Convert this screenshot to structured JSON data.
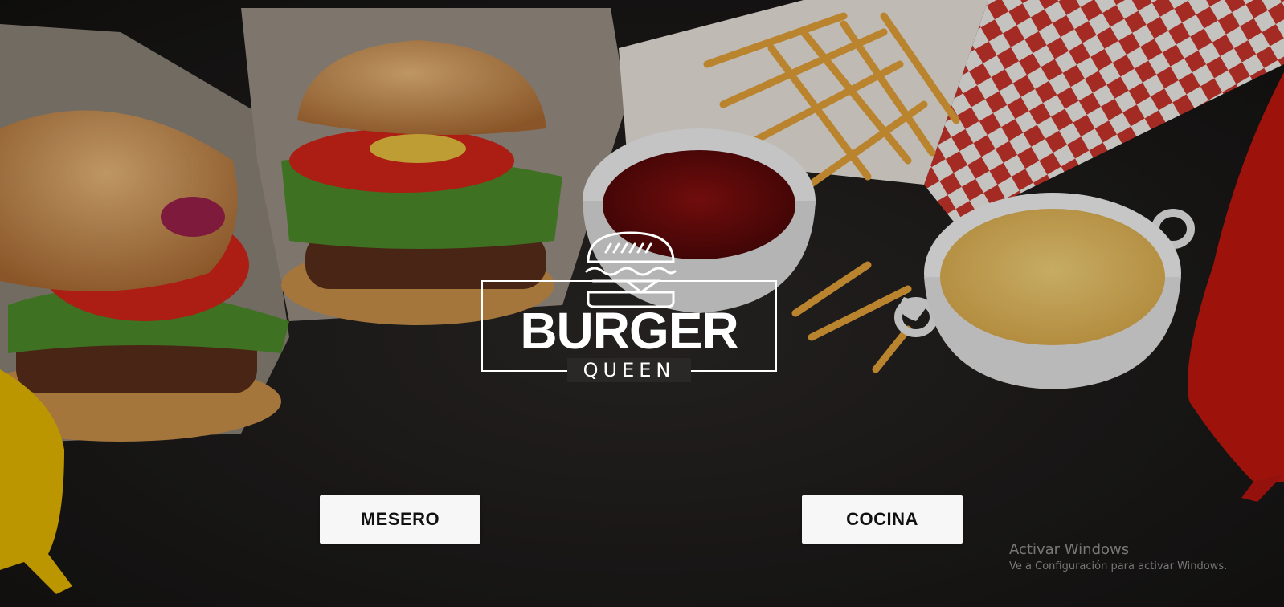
{
  "logo": {
    "brand": "BURGER",
    "sub": "QUEEN"
  },
  "buttons": {
    "mesero_label": "MESERO",
    "cocina_label": "COCINA"
  },
  "watermark": {
    "title": "Activar Windows",
    "subtitle": "Ve a Configuración para activar Windows."
  },
  "colors": {
    "background": "#1c1a19",
    "logo": "#ffffff",
    "button_bg": "#f7f7f7",
    "button_text": "#111111"
  }
}
